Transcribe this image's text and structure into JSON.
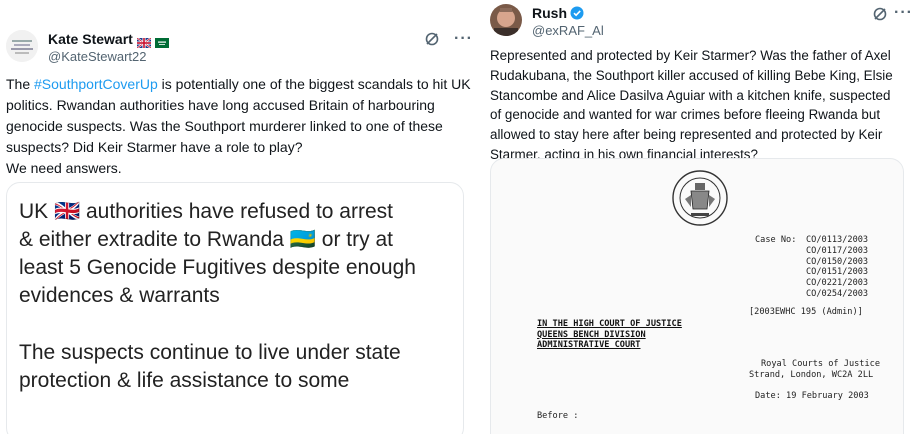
{
  "left_tweet": {
    "author_name": "Kate Stewart",
    "handle": "@KateStewart22",
    "flags": [
      "uk-flag",
      "saudi-flag"
    ],
    "text_before_hashtag": "The ",
    "hashtag": "#SouthportCoverUp",
    "text_after_hashtag": " is potentially one of the biggest scandals to hit UK politics. Rwandan authorities have long accused Britain of harbouring genocide suspects. Was the Southport murderer linked to one of these suspects? Did Keir Starmer have a role to play?",
    "text_last_line": "We need answers.",
    "image_text": {
      "line1": "UK 🇬🇧 authorities have refused to arrest",
      "line2": "& either extradite to Rwanda 🇷🇼 or try at",
      "line3": "least 5 Genocide Fugitives despite enough",
      "line4": "evidences & warrants",
      "line5": "The suspects continue to live under state",
      "line6": "protection & life assistance to some"
    }
  },
  "right_tweet": {
    "author_name": "Rush",
    "handle": "@exRAF_Al",
    "verified": true,
    "text": "Represented and protected by Keir Starmer?   Was the father of Axel Rudakubana, the Southport killer accused of killing Bebe King, Elsie Stancombe and Alice Dasilva Aguiar with a kitchen knife, suspected of genocide and wanted for war crimes before fleeing Rwanda but allowed to stay here after being represented and protected by Keir Starmer, acting in his own financial interests?",
    "document": {
      "case_no_label": "Case No:",
      "case_numbers": [
        "CO/0113/2003",
        "CO/0117/2003",
        "CO/0150/2003",
        "CO/0151/2003",
        "CO/0221/2003",
        "CO/0254/2003"
      ],
      "citation": "[2003EWHC 195 (Admin)]",
      "court_line1": "IN THE HIGH COURT OF JUSTICE",
      "court_line2": "QUEENS BENCH DIVISION",
      "court_line3": "ADMINISTRATIVE COURT",
      "venue_line1": "Royal Courts of Justice",
      "venue_line2": "Strand, London, WC2A 2LL",
      "date": "Date: 19 February 2003",
      "before": "Before :"
    }
  },
  "colors": {
    "text": "#0f1419",
    "secondary": "#536471",
    "link": "#1d9bf0",
    "verified": "#1d9bf0"
  },
  "icons": [
    "grok-icon",
    "more-icon",
    "verified-icon",
    "royal-seal"
  ]
}
